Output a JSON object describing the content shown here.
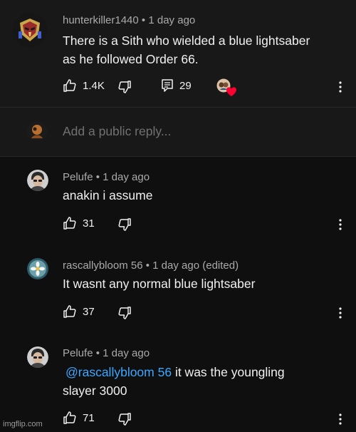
{
  "main_comment": {
    "author": "hunterkiller1440",
    "time": "1 day ago",
    "text_line1": "There is a Sith who wielded a blue lightsaber",
    "text_line2": "as he followed Order 66.",
    "likes": "1.4K",
    "reply_count": "29"
  },
  "reply_box": {
    "placeholder": "Add a public reply..."
  },
  "replies": [
    {
      "author": "Pelufe",
      "time": "1 day ago",
      "text_line1": "anakin i assume",
      "likes": "31"
    },
    {
      "author": "rascallybloom 56",
      "time": "1 day ago (edited)",
      "text_line1": "It wasnt any normal blue lightsaber",
      "likes": "37"
    },
    {
      "author": "Pelufe",
      "time": "1 day ago",
      "mention": "@rascallybloom 56",
      "text_line1_rest": " it was the youngling",
      "text_line2": "slayer 3000",
      "likes": "71"
    }
  ],
  "separator": "•",
  "watermark": "imgflip.com",
  "icons": [
    "like-icon",
    "dislike-icon",
    "reply-icon",
    "more-options-icon",
    "creator-heart-icon"
  ],
  "colors": {
    "background": "#0f0f0f",
    "text": "#f1f1f1",
    "meta": "#aaaaaa",
    "mention": "#3ea6ff",
    "heart": "#ff0033"
  }
}
